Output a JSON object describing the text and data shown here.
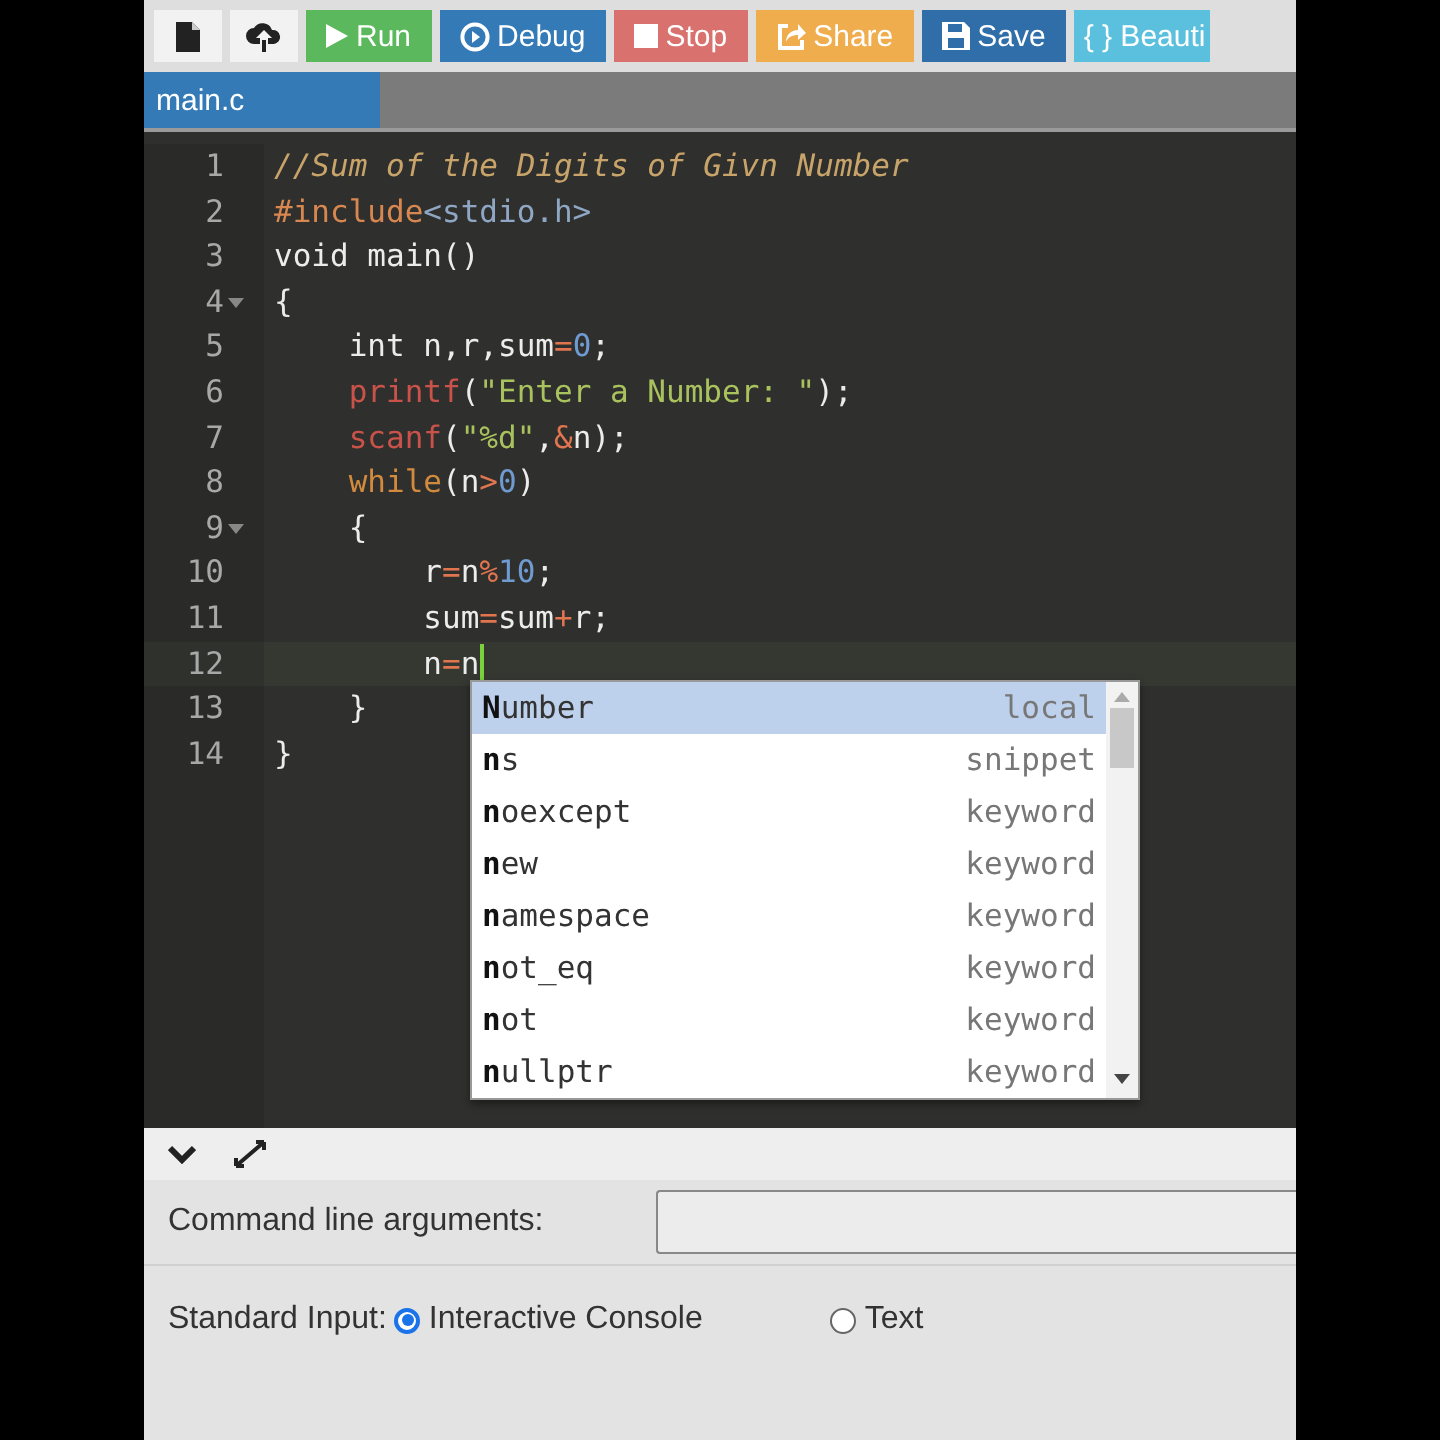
{
  "toolbar": {
    "buttons": [
      {
        "kind": "icon"
      },
      {
        "kind": "icon"
      },
      {
        "kind": "label",
        "label": "Run",
        "color": "#5cb85c"
      },
      {
        "kind": "label",
        "label": "Debug",
        "color": "#337ab7"
      },
      {
        "kind": "label",
        "label": "Stop",
        "color": "#d9716e"
      },
      {
        "kind": "label",
        "label": "Share",
        "color": "#f0ad4e"
      },
      {
        "kind": "label",
        "label": "Save",
        "color": "#2f6ea8"
      },
      {
        "kind": "label",
        "label": "{ } Beauti",
        "color": "#5bc0de"
      }
    ]
  },
  "tabs": [
    {
      "label": "main.c",
      "selected": true
    }
  ],
  "editor": {
    "lines": [
      {
        "number": "1",
        "fold": false,
        "active": false,
        "tokens": [
          {
            "text": "//Sum of the Digits of Givn Number",
            "kind": "comment"
          }
        ]
      },
      {
        "number": "2",
        "fold": false,
        "active": false,
        "tokens": [
          {
            "text": "#include",
            "kind": "meta"
          },
          {
            "text": "<stdio.h>",
            "kind": "header"
          }
        ]
      },
      {
        "number": "3",
        "fold": false,
        "active": false,
        "tokens": [
          {
            "text": "void main()",
            "kind": "plain"
          }
        ]
      },
      {
        "number": "4",
        "fold": true,
        "active": false,
        "tokens": [
          {
            "text": "{",
            "kind": "plain"
          }
        ]
      },
      {
        "number": "5",
        "fold": false,
        "active": false,
        "tokens": [
          {
            "text": "    int n,r,sum",
            "kind": "plain"
          },
          {
            "text": "=",
            "kind": "operator"
          },
          {
            "text": "0",
            "kind": "number"
          },
          {
            "text": ";",
            "kind": "plain"
          }
        ]
      },
      {
        "number": "6",
        "fold": false,
        "active": false,
        "tokens": [
          {
            "text": "    printf",
            "kind": "builtin"
          },
          {
            "text": "(",
            "kind": "plain"
          },
          {
            "text": "\"Enter a Number: \"",
            "kind": "string"
          },
          {
            "text": ");",
            "kind": "plain"
          }
        ]
      },
      {
        "number": "7",
        "fold": false,
        "active": false,
        "tokens": [
          {
            "text": "    scanf",
            "kind": "builtin"
          },
          {
            "text": "(",
            "kind": "plain"
          },
          {
            "text": "\"%d\"",
            "kind": "string"
          },
          {
            "text": ",",
            "kind": "plain"
          },
          {
            "text": "&",
            "kind": "operator"
          },
          {
            "text": "n);",
            "kind": "plain"
          }
        ]
      },
      {
        "number": "8",
        "fold": false,
        "active": false,
        "tokens": [
          {
            "text": "    while",
            "kind": "keyword"
          },
          {
            "text": "(n",
            "kind": "plain"
          },
          {
            "text": ">",
            "kind": "operator"
          },
          {
            "text": "0",
            "kind": "number"
          },
          {
            "text": ")",
            "kind": "plain"
          }
        ]
      },
      {
        "number": "9",
        "fold": true,
        "active": false,
        "tokens": [
          {
            "text": "    {",
            "kind": "plain"
          }
        ]
      },
      {
        "number": "10",
        "fold": false,
        "active": false,
        "tokens": [
          {
            "text": "        r",
            "kind": "plain"
          },
          {
            "text": "=",
            "kind": "operator"
          },
          {
            "text": "n",
            "kind": "plain"
          },
          {
            "text": "%",
            "kind": "operator"
          },
          {
            "text": "10",
            "kind": "number"
          },
          {
            "text": ";",
            "kind": "plain"
          }
        ]
      },
      {
        "number": "11",
        "fold": false,
        "active": false,
        "tokens": [
          {
            "text": "        sum",
            "kind": "plain"
          },
          {
            "text": "=",
            "kind": "operator"
          },
          {
            "text": "sum",
            "kind": "plain"
          },
          {
            "text": "+",
            "kind": "operator"
          },
          {
            "text": "r;",
            "kind": "plain"
          }
        ]
      },
      {
        "number": "12",
        "fold": false,
        "active": true,
        "tokens": [
          {
            "text": "        n",
            "kind": "plain"
          },
          {
            "text": "=",
            "kind": "operator"
          },
          {
            "text": "n",
            "kind": "plain"
          }
        ]
      },
      {
        "number": "13",
        "fold": false,
        "active": false,
        "tokens": [
          {
            "text": "    }",
            "kind": "plain"
          }
        ]
      },
      {
        "number": "14",
        "fold": false,
        "active": false,
        "tokens": [
          {
            "text": "}",
            "kind": "plain"
          }
        ]
      }
    ],
    "autocomplete": [
      {
        "text": "**N**umber",
        "type": "local",
        "selected": true
      },
      {
        "text": "**n**s",
        "type": "snippet",
        "selected": false
      },
      {
        "text": "**n**oexcept",
        "type": "keyword",
        "selected": false
      },
      {
        "text": "**n**ew",
        "type": "keyword",
        "selected": false
      },
      {
        "text": "**n**amespace",
        "type": "keyword",
        "selected": false
      },
      {
        "text": "**n**ot_eq",
        "type": "keyword",
        "selected": false
      },
      {
        "text": "**n**ot",
        "type": "keyword",
        "selected": false
      },
      {
        "text": "**n**ullptr",
        "type": "keyword",
        "selected": false
      }
    ]
  },
  "bottom_panel": {
    "command_line_label": "Command line arguments:",
    "standard_input_label": "Standard Input:",
    "input_options": [
      {
        "label": "Interactive Console",
        "selected": true
      },
      {
        "label": "Text",
        "selected": false
      }
    ]
  }
}
